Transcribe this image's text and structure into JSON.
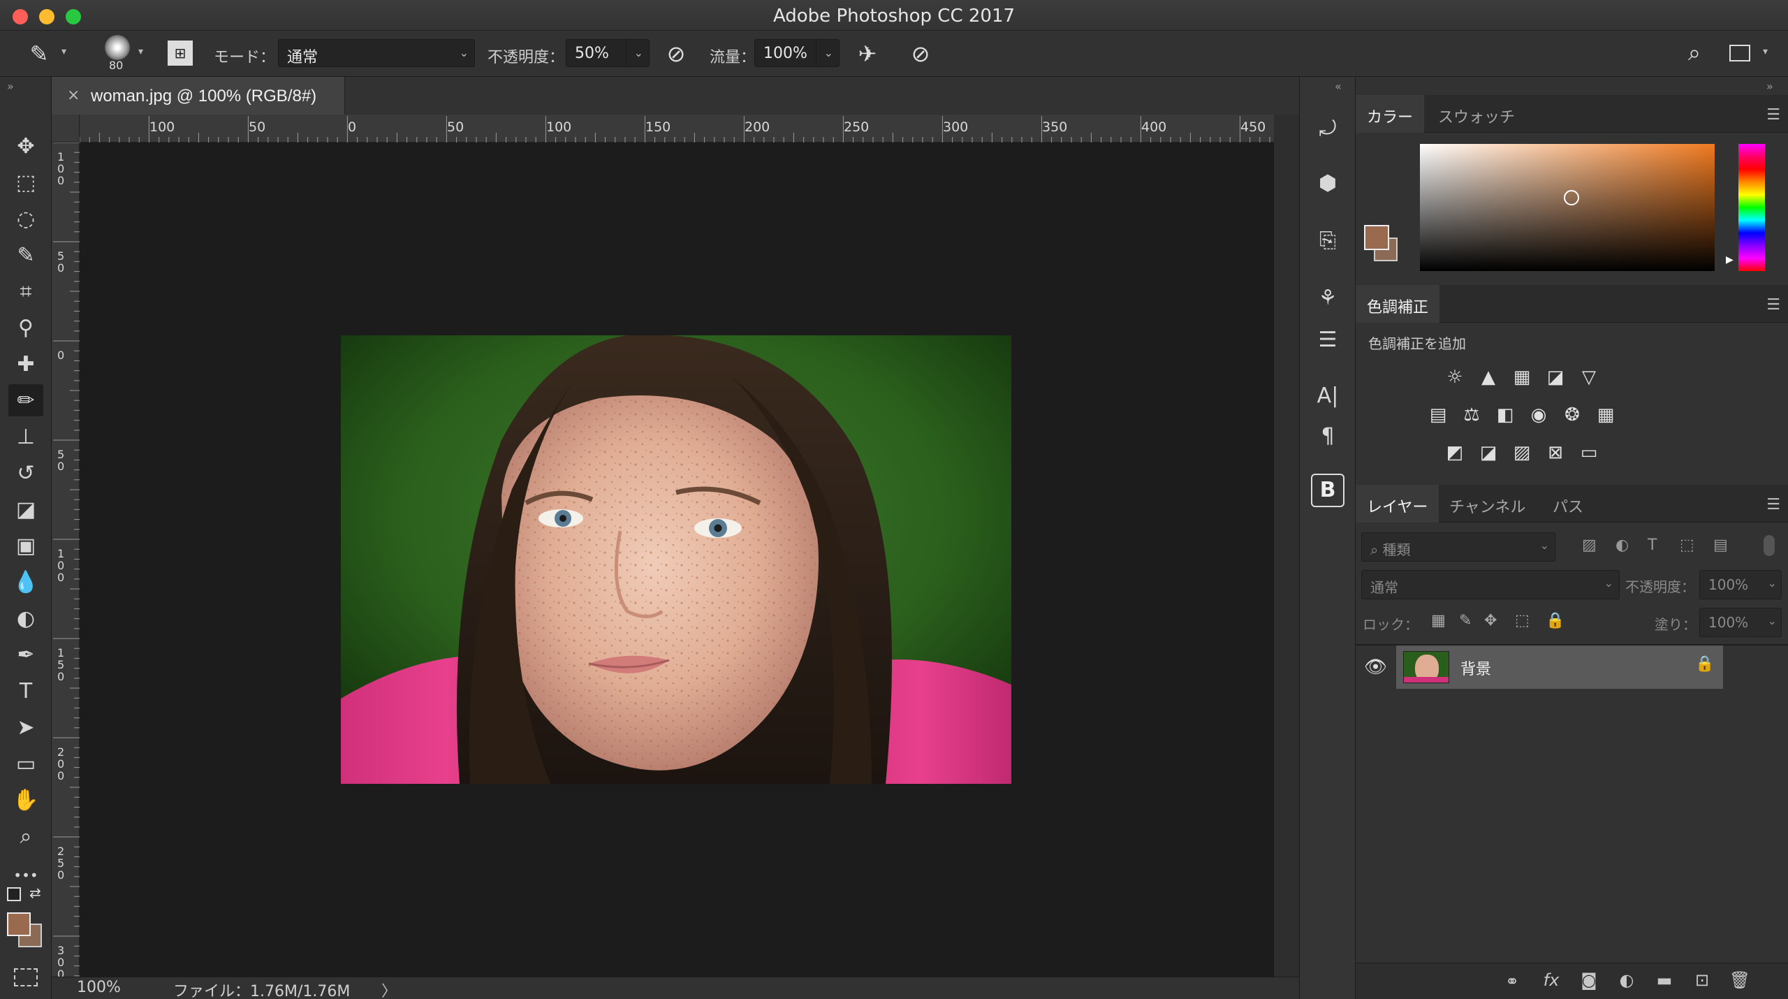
{
  "window": {
    "title": "Adobe Photoshop CC 2017"
  },
  "traffic_lights": {
    "close": "#ff5f57",
    "minimize": "#febc2e",
    "zoom": "#28c840"
  },
  "options_bar": {
    "brush_size": "80",
    "mode_label": "モード：",
    "mode_value": "通常",
    "opacity_label": "不透明度：",
    "opacity_value": "50%",
    "flow_label": "流量：",
    "flow_value": "100%"
  },
  "tools": [
    {
      "name": "move-tool",
      "icon": "✥"
    },
    {
      "name": "marquee-tool",
      "icon": "⬚"
    },
    {
      "name": "lasso-tool",
      "icon": "◌"
    },
    {
      "name": "quick-select-tool",
      "icon": "✎"
    },
    {
      "name": "crop-tool",
      "icon": "⌗"
    },
    {
      "name": "eyedropper-tool",
      "icon": "⚲"
    },
    {
      "name": "healing-brush-tool",
      "icon": "✚"
    },
    {
      "name": "brush-tool",
      "icon": "✏"
    },
    {
      "name": "clone-stamp-tool",
      "icon": "⊥"
    },
    {
      "name": "history-brush-tool",
      "icon": "↺"
    },
    {
      "name": "eraser-tool",
      "icon": "◪"
    },
    {
      "name": "gradient-tool",
      "icon": "▣"
    },
    {
      "name": "blur-tool",
      "icon": "💧"
    },
    {
      "name": "dodge-tool",
      "icon": "◐"
    },
    {
      "name": "pen-tool",
      "icon": "✒"
    },
    {
      "name": "type-tool",
      "icon": "T"
    },
    {
      "name": "path-select-tool",
      "icon": "➤"
    },
    {
      "name": "rectangle-tool",
      "icon": "▭"
    },
    {
      "name": "hand-tool",
      "icon": "✋"
    },
    {
      "name": "zoom-tool",
      "icon": "⌕"
    },
    {
      "name": "more-tools",
      "icon": "•••"
    }
  ],
  "document": {
    "tab_title": "woman.jpg @ 100% (RGB/8#)",
    "close_glyph": "×"
  },
  "ruler_top": [
    "100",
    "50",
    "0",
    "50",
    "100",
    "150",
    "200",
    "250",
    "300",
    "350",
    "400",
    "450"
  ],
  "ruler_left": [
    "100",
    "50",
    "0",
    "50",
    "100",
    "150",
    "200",
    "250",
    "300"
  ],
  "status": {
    "zoom": "100%",
    "file_info": "ファイル：1.76M/1.76M",
    "arrow": "〉"
  },
  "color_panel": {
    "tabs": [
      "カラー",
      "スウォッチ"
    ],
    "fg_color": "#9a6a4e",
    "bg_color": "#8b6b55",
    "hue_color": "#f07a20"
  },
  "adjustments_panel": {
    "tab": "色調補正",
    "subtitle": "色調補正を追加"
  },
  "layers_panel": {
    "tabs": [
      "レイヤー",
      "チャンネル",
      "パス"
    ],
    "filter_placeholder": "⌕ 種類",
    "blend_mode": "通常",
    "opacity_label": "不透明度：",
    "opacity_value": "100%",
    "lock_label": "ロック：",
    "fill_label": "塗り：",
    "fill_value": "100%",
    "layers": [
      {
        "name": "背景",
        "visible": true,
        "locked": true
      }
    ]
  },
  "panel_footer_icons": [
    "link-icon",
    "fx-icon",
    "mask-icon",
    "adjustment-icon",
    "folder-icon",
    "new-layer-icon",
    "trash-icon"
  ],
  "footer_glyphs": {
    "fx": "fx"
  }
}
